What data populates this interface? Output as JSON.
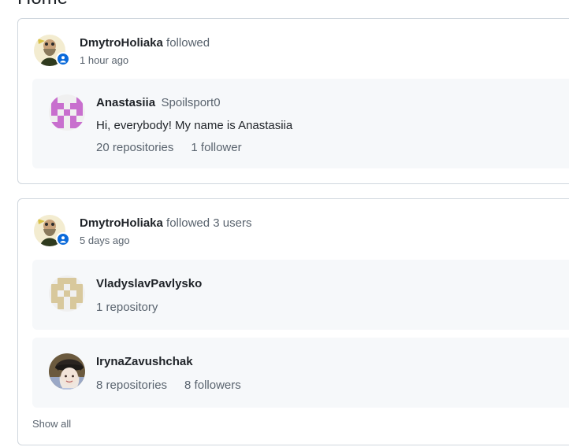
{
  "page": {
    "title": "Home"
  },
  "feed": [
    {
      "actor": "DmytroHoliaka",
      "action": "followed",
      "time": "1 hour ago",
      "user": {
        "name": "Anastasiia",
        "login": "Spoilsport0",
        "bio": "Hi, everybody! My name is Anastasiia",
        "repositories": "20 repositories",
        "followers": "1 follower"
      }
    },
    {
      "actor": "DmytroHoliaka",
      "action": "followed 3 users",
      "time": "5 days ago",
      "users": [
        {
          "name": "VladyslavPavlysko",
          "repositories": "1 repository"
        },
        {
          "name": "IrynaZavushchak",
          "repositories": "8 repositories",
          "followers": "8 followers"
        }
      ],
      "show_all": "Show all"
    }
  ],
  "colors": {
    "badge": "#0969da",
    "identicon_pink": "#c86fce",
    "identicon_tan": "#d8c89c"
  },
  "icons": {
    "badge": "person-icon"
  }
}
